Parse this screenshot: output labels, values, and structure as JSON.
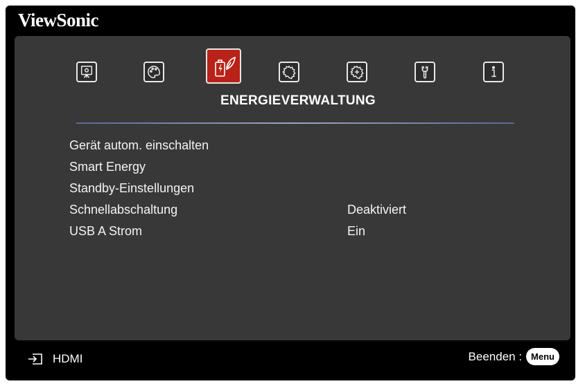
{
  "brand": "ViewSonic",
  "section_title": "ENERGIEVERWALTUNG",
  "tabs": [
    {
      "icon": "display-icon"
    },
    {
      "icon": "palette-icon"
    },
    {
      "icon": "power-eco-icon",
      "active": true
    },
    {
      "icon": "gear-icon"
    },
    {
      "icon": "advanced-gear-icon"
    },
    {
      "icon": "wrench-icon"
    },
    {
      "icon": "info-icon"
    }
  ],
  "menu": [
    {
      "label": "Gerät autom. einschalten",
      "value": ""
    },
    {
      "label": "Smart Energy",
      "value": ""
    },
    {
      "label": "Standby-Einstellungen",
      "value": ""
    },
    {
      "label": "Schnellabschaltung",
      "value": "Deaktiviert"
    },
    {
      "label": "USB A Strom",
      "value": "Ein"
    }
  ],
  "footer": {
    "source": "HDMI",
    "exit_label": "Beenden :",
    "menu_key": "Menu"
  },
  "colors": {
    "active_tab": "#b82218",
    "panel": "#383838",
    "background": "#000000"
  }
}
